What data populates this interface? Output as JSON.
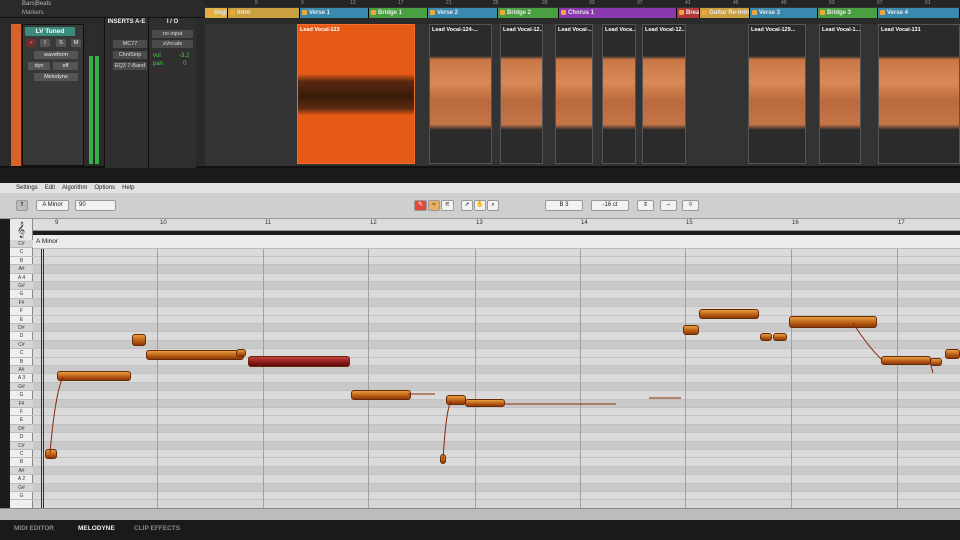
{
  "ruler": {
    "label": "Bars|Beats",
    "ticks": [
      "5",
      "9",
      "13",
      "17",
      "21",
      "25",
      "29",
      "33",
      "37",
      "41",
      "45",
      "49",
      "53",
      "57",
      "61"
    ]
  },
  "markers": {
    "label": "Markers",
    "sections": [
      {
        "name": "SngSt",
        "color": "#e0b040"
      },
      {
        "name": "Intro",
        "color": "#c8a040"
      },
      {
        "name": "Verse 1",
        "color": "#3a8ab0"
      },
      {
        "name": "Bridge 1",
        "color": "#4aa040"
      },
      {
        "name": "Verse 2",
        "color": "#3a8ab0"
      },
      {
        "name": "Bridge 2",
        "color": "#4aa040"
      },
      {
        "name": "Chorus 1",
        "color": "#8a3ab0"
      },
      {
        "name": "Break",
        "color": "#b03a3a"
      },
      {
        "name": "Guitar Re-Intro",
        "color": "#c8a040"
      },
      {
        "name": "Verse 3",
        "color": "#3a8ab0"
      },
      {
        "name": "Bridge 3",
        "color": "#4aa040"
      },
      {
        "name": "Verse 4",
        "color": "#3a8ab0"
      }
    ]
  },
  "track": {
    "name": "LV Tuned",
    "buttons": {
      "rec": "●",
      "input": "I",
      "solo": "S",
      "mute": "M"
    },
    "view": "waveform",
    "dyn": "dyn",
    "off": "off",
    "plugin": "Melodyne",
    "color": "#d8622a"
  },
  "inserts": {
    "header": "INSERTS A-E",
    "items": [
      "MC77",
      "ChnlStrip",
      "EQ3 7-Band"
    ]
  },
  "io": {
    "header": "I / O",
    "input": "no input",
    "output": "sVocals",
    "vol_label": "vol",
    "vol_value": "-3.2",
    "pan_label": "pan",
    "pan_value": "0"
  },
  "clips": [
    {
      "name": "Lead Vocal-123",
      "selected": true
    },
    {
      "name": "Lead Vocal-124-...",
      "selected": false
    },
    {
      "name": "Lead Vocal-12...",
      "selected": false
    },
    {
      "name": "Lead Vocal-...",
      "selected": false
    },
    {
      "name": "Lead Voca...",
      "selected": false
    },
    {
      "name": "Lead Vocal-12...",
      "selected": false
    },
    {
      "name": "Lead Vocal-129...",
      "selected": false
    },
    {
      "name": "Lead Vocal-1...",
      "selected": false
    },
    {
      "name": "Lead Vocal-131",
      "selected": false
    }
  ],
  "melodyne": {
    "menu": [
      "Settings",
      "Edit",
      "Algorithm",
      "Options",
      "Help"
    ],
    "key": "A Minor",
    "tempo": "90",
    "pitch_readout": "B 3",
    "cents_readout": "-16 ct",
    "scale_label": "A Minor",
    "bars": [
      "9",
      "10",
      "11",
      "12",
      "13",
      "14",
      "15",
      "16",
      "17"
    ],
    "keys": [
      "C#",
      "C",
      "B",
      "A#",
      "A 4",
      "G#",
      "G",
      "F#",
      "F",
      "E",
      "D#",
      "D",
      "C#",
      "C",
      "B",
      "A#",
      "A 3",
      "G#",
      "G",
      "F#",
      "F",
      "E",
      "D#",
      "D",
      "C#",
      "C",
      "B",
      "A#",
      "A 2",
      "G#",
      "G"
    ]
  },
  "bottom_tabs": [
    {
      "label": "MIDI EDITOR",
      "active": false
    },
    {
      "label": "MELODYNE",
      "active": true
    },
    {
      "label": "CLIP EFFECTS",
      "active": false
    }
  ]
}
